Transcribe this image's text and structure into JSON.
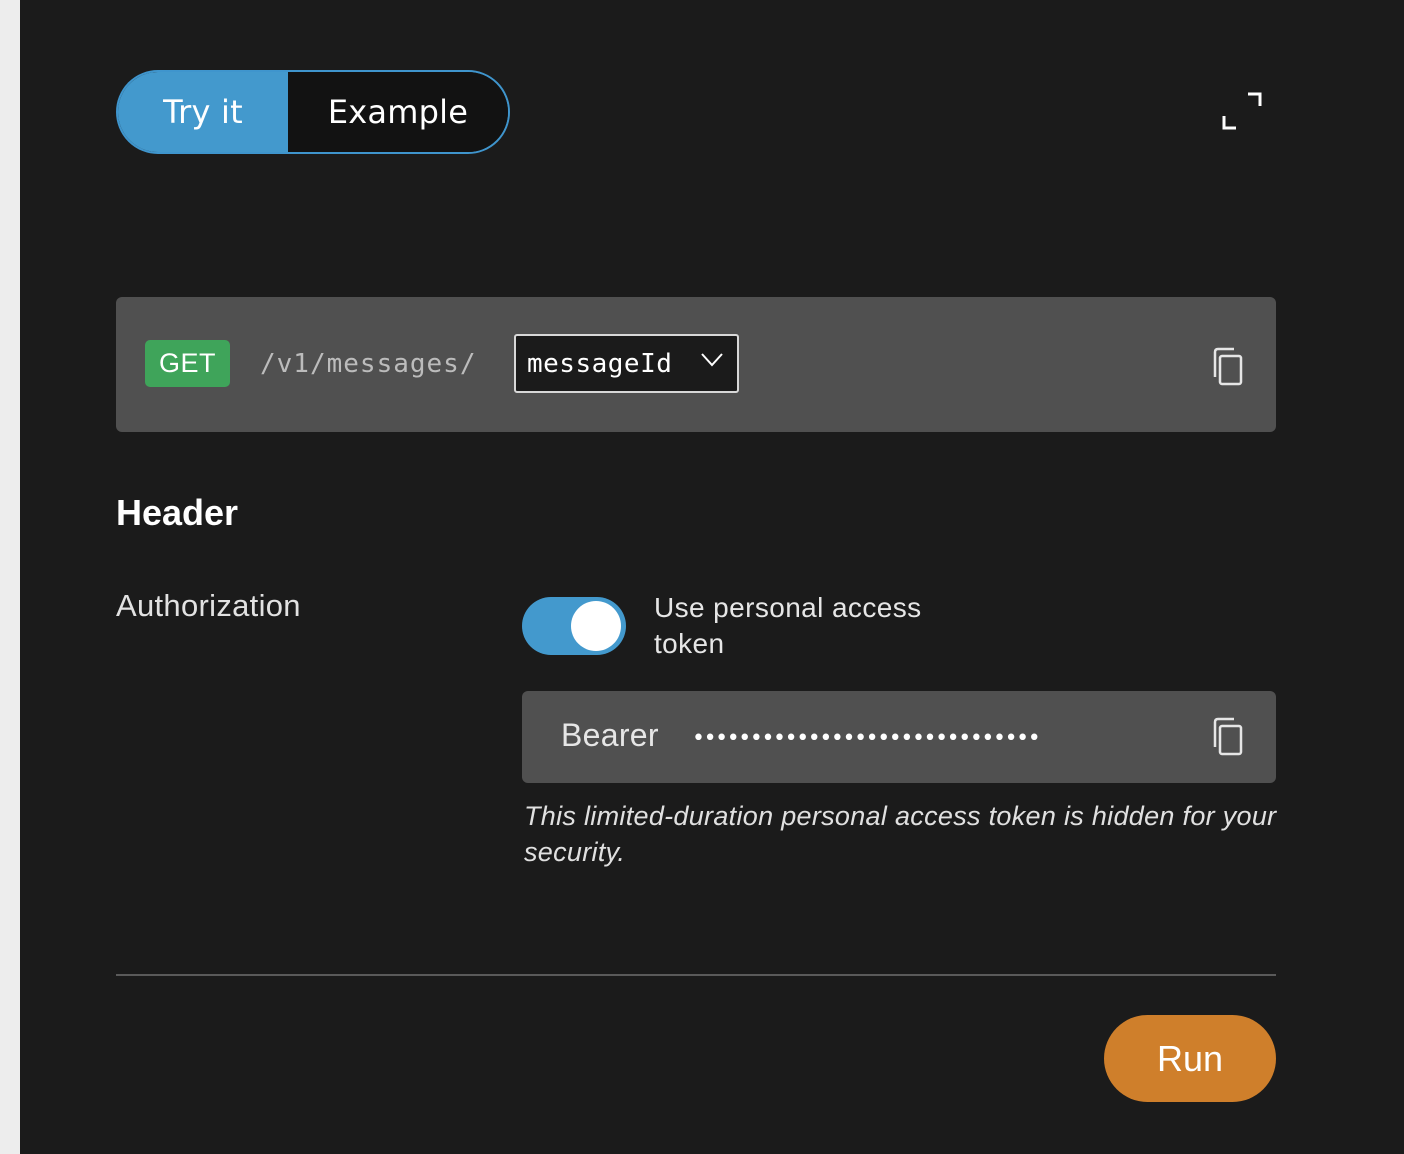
{
  "tabs": {
    "try_label": "Try it",
    "example_label": "Example",
    "active": "try"
  },
  "toolbar": {
    "expand_icon": "expand-icon"
  },
  "request": {
    "method": "GET",
    "path": "/v1/messages/",
    "param_value": "messageId",
    "copy_icon": "copy-icon"
  },
  "header_section": {
    "title": "Header",
    "auth_label": "Authorization",
    "toggle_on": true,
    "toggle_label": "Use personal access token",
    "token_prefix": "Bearer",
    "token_mask": "••••••••••••••••••••••••••••••",
    "hint": "This limited-duration personal access token is hidden for your security."
  },
  "actions": {
    "run_label": "Run"
  },
  "colors": {
    "accent_blue": "#4399cd",
    "method_green": "#3fa45a",
    "run_orange": "#cf7f2b",
    "background": "#1b1b1b",
    "field_bg": "#505050"
  }
}
